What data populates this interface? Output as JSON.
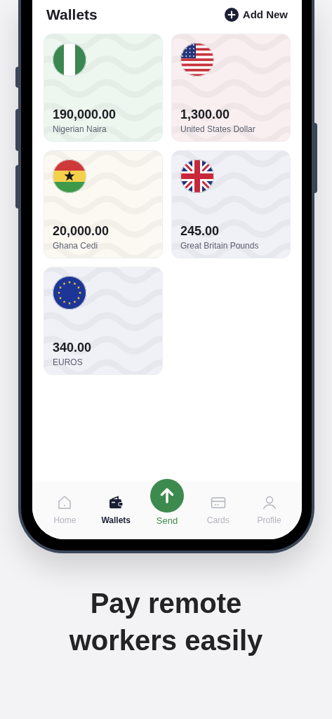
{
  "header": {
    "title": "Wallets",
    "action": "Add New"
  },
  "wallets": [
    {
      "amount": "190,000.00",
      "currency": "Nigerian Naira",
      "kind": "ng",
      "color": "#edf7f0"
    },
    {
      "amount": "1,300.00",
      "currency": "United States Dollar",
      "kind": "us",
      "color": "#f9eff0"
    },
    {
      "amount": "20,000.00",
      "currency": "Ghana Cedi",
      "kind": "gh",
      "color": "#fbf9f2"
    },
    {
      "amount": "245.00",
      "currency": "Great Britain Pounds",
      "kind": "gb",
      "color": "#f0f1f7"
    },
    {
      "amount": "340.00",
      "currency": "EUROS",
      "kind": "eu",
      "color": "#f0f1f7"
    }
  ],
  "nav": [
    {
      "label": "Home",
      "kind": "home",
      "selected": false
    },
    {
      "label": "Wallets",
      "kind": "wallet",
      "selected": true
    },
    {
      "label": "Send",
      "kind": "send",
      "selected": false
    },
    {
      "label": "Cards",
      "kind": "card",
      "selected": false
    },
    {
      "label": "Profile",
      "kind": "profile",
      "selected": false
    }
  ],
  "tagline": "Pay remote workers easily"
}
